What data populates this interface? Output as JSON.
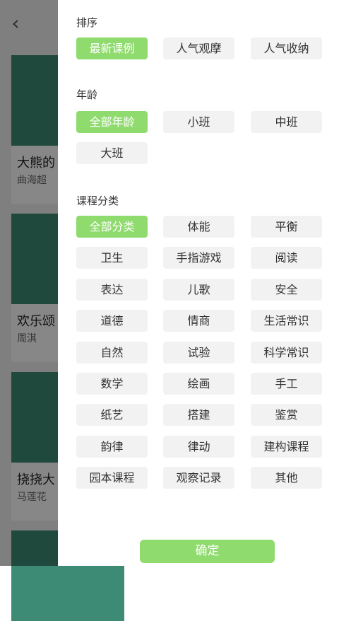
{
  "background": {
    "back_icon": "chevron-left-icon",
    "cards": [
      {
        "title": "大熊的",
        "author": "曲海超"
      },
      {
        "title": "欢乐颂",
        "author": "周淇"
      },
      {
        "title": "挠挠大",
        "author": "马莲花"
      }
    ]
  },
  "filters": {
    "sort": {
      "title": "排序",
      "options": [
        "最新课例",
        "人气观摩",
        "人气收纳"
      ],
      "selected": "最新课例"
    },
    "age": {
      "title": "年龄",
      "options": [
        "全部年龄",
        "小班",
        "中班",
        "大班"
      ],
      "selected": "全部年龄"
    },
    "category": {
      "title": "课程分类",
      "options": [
        "全部分类",
        "体能",
        "平衡",
        "卫生",
        "手指游戏",
        "阅读",
        "表达",
        "儿歌",
        "安全",
        "道德",
        "情商",
        "生活常识",
        "自然",
        "试验",
        "科学常识",
        "数学",
        "绘画",
        "手工",
        "纸艺",
        "搭建",
        "鉴赏",
        "韵律",
        "律动",
        "建构课程",
        "园本课程",
        "观察记录",
        "其他"
      ],
      "selected": "全部分类"
    }
  },
  "confirm_label": "确定",
  "colors": {
    "accent": "#8fdb6e",
    "chip_bg": "#f2f2f2",
    "thumb": "#3d8a75"
  }
}
